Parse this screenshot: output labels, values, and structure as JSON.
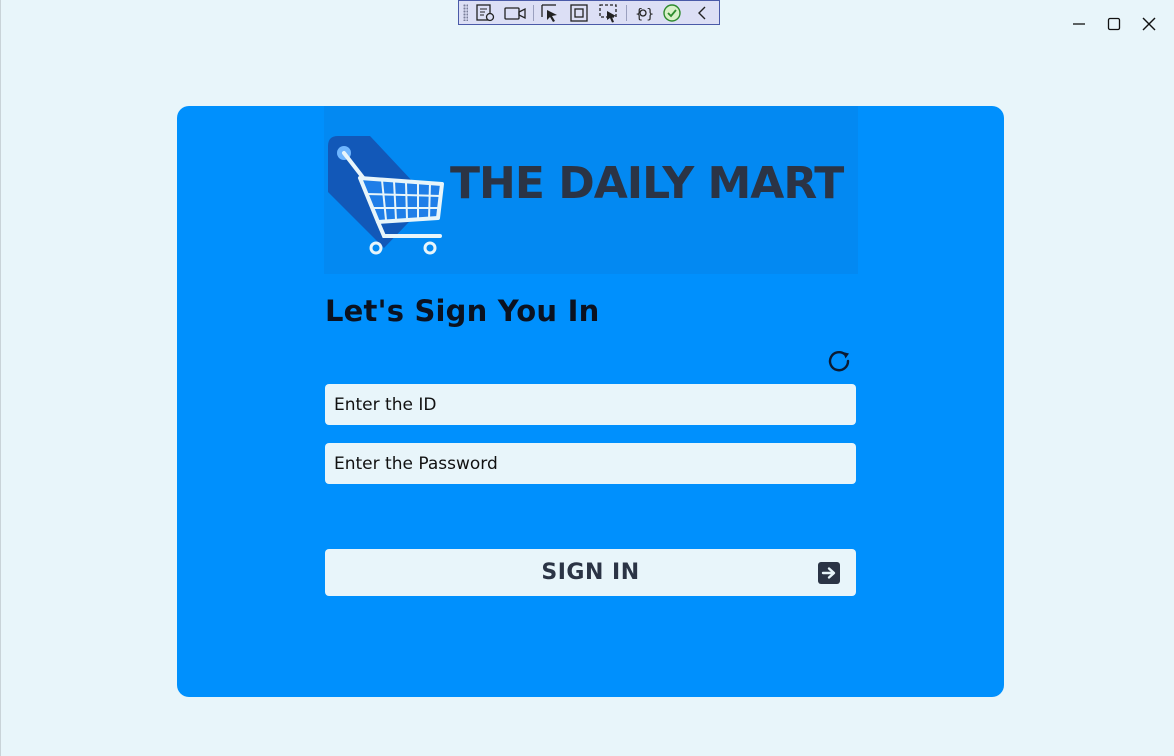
{
  "app": {
    "brand_name": "THE DAILY MART",
    "heading": "Let's Sign You In"
  },
  "form": {
    "id_placeholder": "Enter the ID",
    "password_placeholder": "Enter the Password",
    "signin_label": "SIGN IN"
  },
  "icons": {
    "logo": "shopping-cart-tag-icon",
    "refresh": "refresh-icon",
    "signin": "arrow-right-square-icon"
  },
  "toolbar": {
    "items": [
      "live-visual-tree-icon",
      "record-icon",
      "select-element-icon",
      "display-layout-adorners-icon",
      "track-focus-icon",
      "binding-failures-icon",
      "hot-reload-icon",
      "collapse-toolbar-icon"
    ]
  },
  "colors": {
    "card": "#0090fd",
    "background": "#e8f5fa",
    "text_dark": "#2b3445"
  }
}
